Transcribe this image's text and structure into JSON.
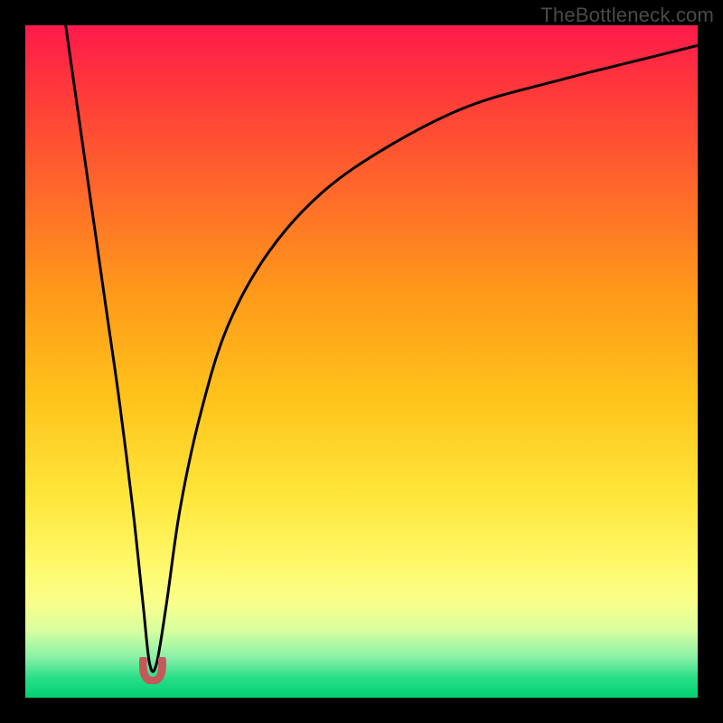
{
  "watermark": "TheBottleneck.com",
  "colors": {
    "frame_bg": "#000000",
    "curve_stroke": "#000000",
    "dip_stroke": "#c25a5a",
    "gradient_top": "#ff1a4b",
    "gradient_bottom": "#00d070"
  },
  "chart_data": {
    "type": "line",
    "title": "",
    "xlabel": "",
    "ylabel": "",
    "xlim": [
      0,
      100
    ],
    "ylim": [
      0,
      100
    ],
    "annotations": [],
    "series": [
      {
        "name": "bottleneck-curve",
        "x": [
          6,
          8,
          10,
          12,
          14,
          16,
          17.5,
          18.5,
          19.5,
          21,
          23,
          26,
          30,
          36,
          44,
          54,
          66,
          80,
          92,
          100
        ],
        "y": [
          100,
          86,
          72,
          58,
          44,
          28,
          14,
          5,
          5,
          14,
          28,
          42,
          55,
          66,
          75,
          82,
          88,
          92,
          95,
          97
        ]
      }
    ],
    "dip_marker": {
      "x": 19,
      "y": 2,
      "width": 4,
      "height": 4
    }
  }
}
